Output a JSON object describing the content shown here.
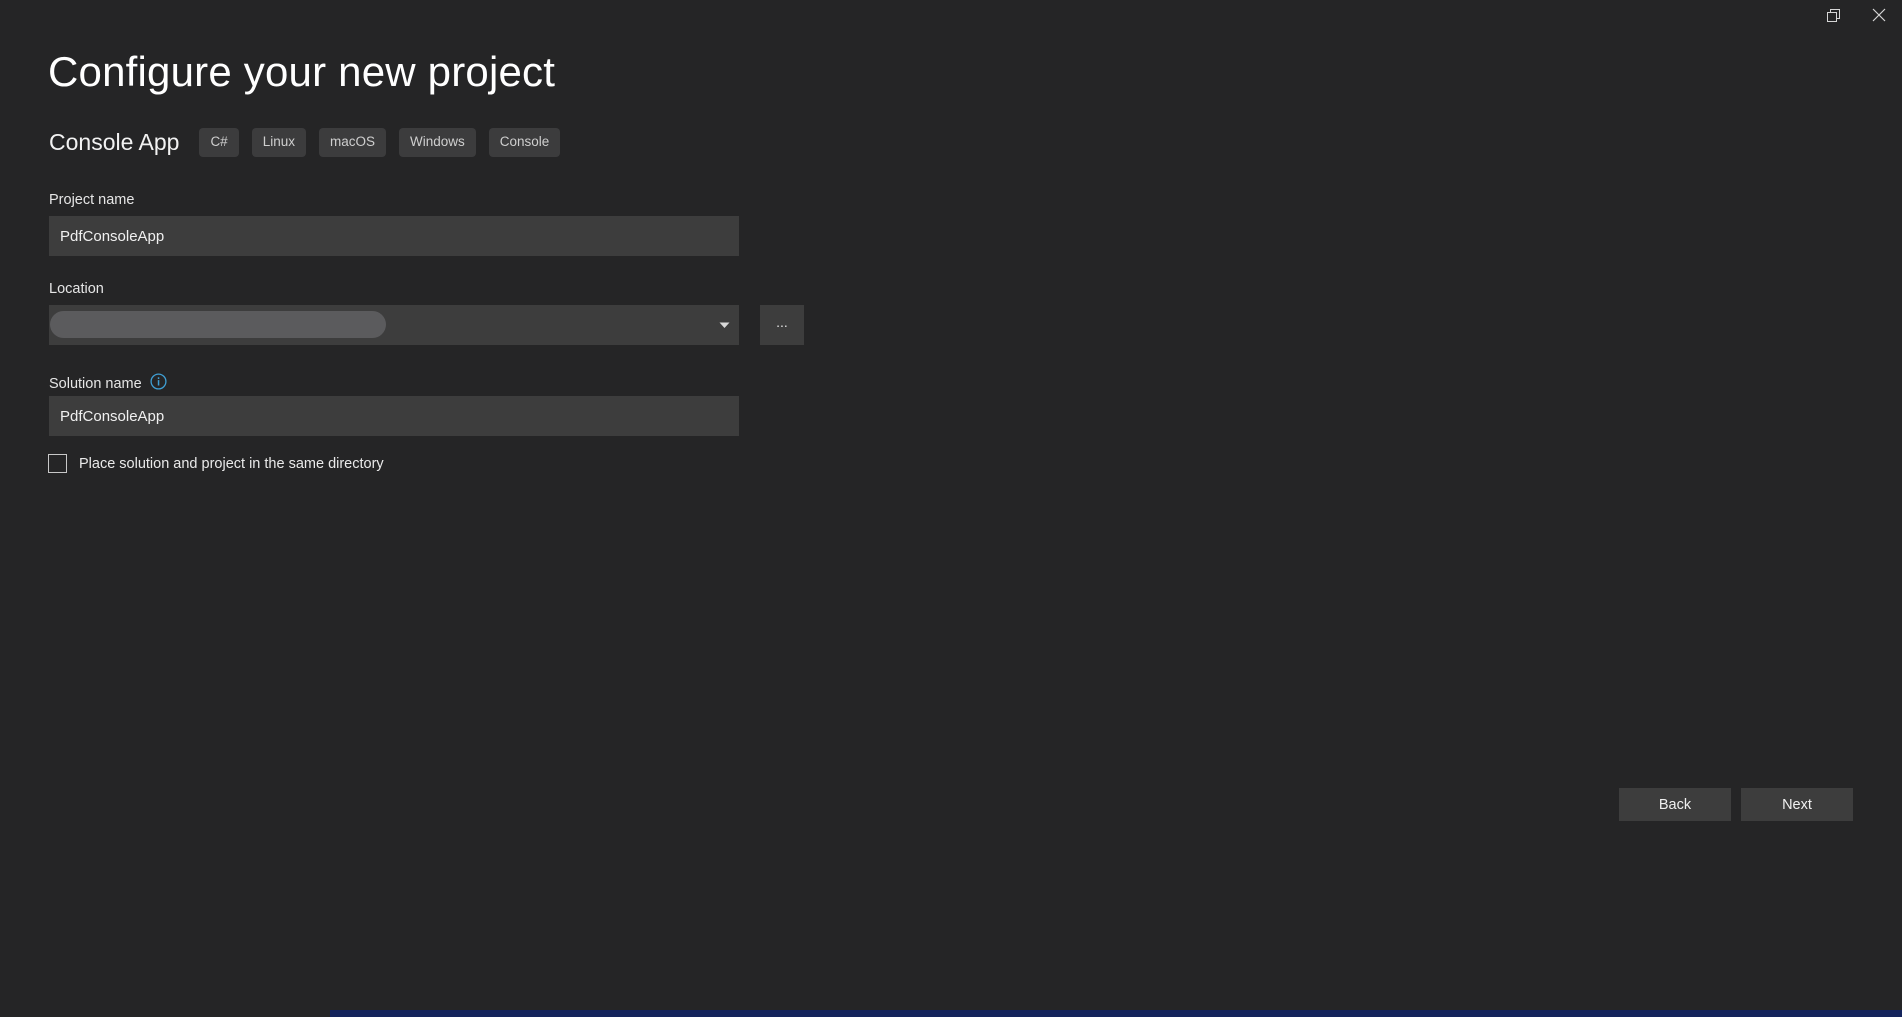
{
  "window": {
    "restore_icon": "restore-window-icon",
    "close_icon": "close-window-icon"
  },
  "page": {
    "title": "Configure your new project"
  },
  "template": {
    "name": "Console App",
    "tags": [
      "C#",
      "Linux",
      "macOS",
      "Windows",
      "Console"
    ]
  },
  "form": {
    "project_name": {
      "label": "Project name",
      "value": "PdfConsoleApp",
      "placeholder": "Project name"
    },
    "location": {
      "label": "Location",
      "value": "",
      "placeholder": "",
      "redacted": true,
      "dropdown_icon": "chevron-down-icon",
      "browse_label": "..."
    },
    "solution_name": {
      "label": "Solution name",
      "value": "PdfConsoleApp",
      "placeholder": "Solution name",
      "info_icon": "info-icon"
    },
    "same_directory": {
      "label": "Place solution and project in the same directory",
      "checked": false
    }
  },
  "footer": {
    "back_label": "Back",
    "next_label": "Next"
  },
  "colors": {
    "background": "#252526",
    "input_background": "#3d3d3d",
    "tag_background": "#3c3c3d",
    "redaction": "#5b5b5d",
    "info_accent": "#3f9fd4",
    "accent_strip": "#14245c"
  }
}
